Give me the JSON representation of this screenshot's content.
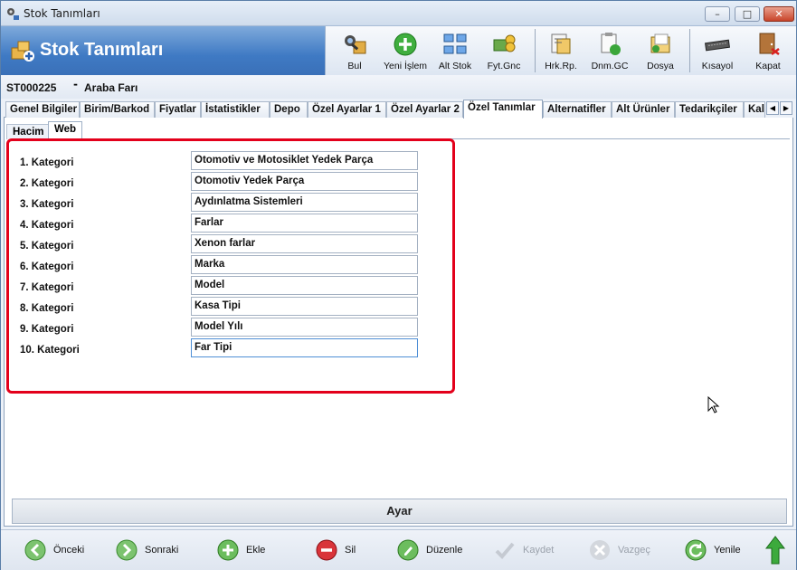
{
  "window": {
    "title": "Stok Tanımları",
    "min": "–",
    "max": "□",
    "close": "✕"
  },
  "banner": {
    "title": "Stok Tanımları"
  },
  "toolbar": [
    {
      "label": "Bul",
      "icon": "search-binoculars-icon"
    },
    {
      "label": "Yeni İşlem",
      "icon": "add-icon"
    },
    {
      "label": "Alt Stok",
      "icon": "sub-stock-icon"
    },
    {
      "label": "Fyt.Gnc",
      "icon": "price-update-icon"
    },
    {
      "label": "Hrk.Rp.",
      "icon": "movement-report-icon"
    },
    {
      "label": "Dnm.GC",
      "icon": "period-icon"
    },
    {
      "label": "Dosya",
      "icon": "file-icon"
    },
    {
      "label": "Kısayol",
      "icon": "keyboard-icon"
    },
    {
      "label": "Kapat",
      "icon": "exit-door-icon"
    }
  ],
  "record": {
    "code": "ST000225",
    "separator": "-",
    "name": "Araba Farı"
  },
  "tabs": [
    "Genel Bilgiler",
    "Birim/Barkod",
    "Fiyatlar",
    "İstatistikler",
    "Depo",
    "Özel Ayarlar 1",
    "Özel Ayarlar 2",
    "Özel Tanımlar",
    "Alternatifler",
    "Alt Ürünler",
    "Tedarikçiler",
    "Kali"
  ],
  "active_tab": "Özel Tanımlar",
  "subtabs": [
    "Hacim",
    "Web"
  ],
  "categories": [
    {
      "label": "1. Kategori",
      "value": "Otomotiv ve Motosiklet Yedek Parça"
    },
    {
      "label": "2. Kategori",
      "value": "Otomotiv Yedek Parça"
    },
    {
      "label": "3. Kategori",
      "value": "Aydınlatma Sistemleri"
    },
    {
      "label": "4. Kategori",
      "value": "Farlar"
    },
    {
      "label": "5. Kategori",
      "value": "Xenon farlar"
    },
    {
      "label": "6. Kategori",
      "value": "Marka"
    },
    {
      "label": "7. Kategori",
      "value": "Model"
    },
    {
      "label": "8. Kategori",
      "value": "Kasa Tipi"
    },
    {
      "label": "9. Kategori",
      "value": "Model Yılı"
    },
    {
      "label": "10. Kategori",
      "value": "Far Tipi"
    }
  ],
  "ayar": "Ayar",
  "bottom": [
    {
      "label": "Önceki",
      "icon": "back-arrow-icon",
      "enabled": true
    },
    {
      "label": "Sonraki",
      "icon": "forward-arrow-icon",
      "enabled": true
    },
    {
      "label": "Ekle",
      "icon": "add-icon",
      "enabled": true
    },
    {
      "label": "Sil",
      "icon": "delete-icon",
      "enabled": true
    },
    {
      "label": "Düzenle",
      "icon": "edit-icon",
      "enabled": true
    },
    {
      "label": "Kaydet",
      "icon": "save-check-icon",
      "enabled": false
    },
    {
      "label": "Vazgeç",
      "icon": "cancel-icon",
      "enabled": false
    },
    {
      "label": "Yenile",
      "icon": "refresh-icon",
      "enabled": true
    },
    {
      "label": "",
      "icon": "up-arrow-icon",
      "enabled": true
    }
  ],
  "colors": {
    "banner": "#3f7ac4",
    "highlight": "#e3001b",
    "green": "#2fa52f",
    "red": "#d2202a"
  }
}
